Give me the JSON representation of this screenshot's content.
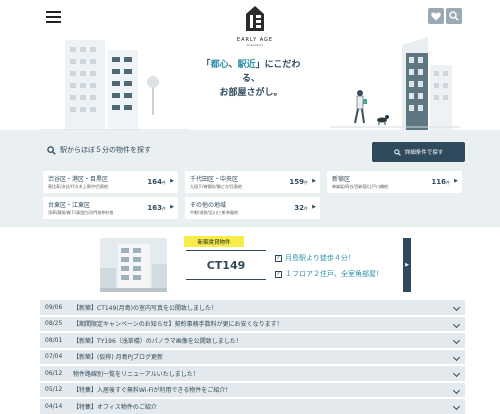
{
  "header": {
    "logo_text": "EARLY AGE",
    "logo_sub": "tsukishima",
    "tagline_line1_open": "「",
    "tagline_hl1": "都心",
    "tagline_sep": "、",
    "tagline_hl2": "駅近",
    "tagline_line1_rest": "」にこだわる、",
    "tagline_line2": "お部屋さがし。",
    "favorite_icon": "heart-icon",
    "search_icon": "search-icon"
  },
  "search": {
    "station_label": "駅からほぼ５分の物件を探す",
    "detail_button": "詳細条件で探す",
    "areas": [
      {
        "name": "渋谷区・港区・目黒区",
        "sub": "恵比寿/渋谷/代々木上原/中目黒他",
        "count": "164",
        "unit": "件"
      },
      {
        "name": "千代田区・中央区",
        "sub": "九段下/神保町/勝どき/月島他",
        "count": "159",
        "unit": "件"
      },
      {
        "name": "新宿区",
        "sub": "神楽坂/四谷/西新宿/江戸川橋他",
        "count": "116",
        "unit": "件"
      },
      {
        "name": "台東区・江東区",
        "sub": "浅草/蔵前/森下/清澄白河/門前仲町他",
        "count": "163",
        "unit": "件"
      },
      {
        "name": "その他の地域",
        "sub": "中野/池袋/品川/三軒茶屋他",
        "count": "32",
        "unit": "件"
      }
    ]
  },
  "new_property": {
    "badge": "新築賃貸物件",
    "name": "CT149",
    "feature1": "月島駅より徒歩４分！",
    "feature2": "１フロア２住戸、全室角部屋！"
  },
  "news": [
    {
      "date": "09/06",
      "title": "【新築】CT149(月島)の室内写真を公開致しました！"
    },
    {
      "date": "08/25",
      "title": "【期間限定キャンペーンのお知らせ】契約事務手数料が更にお安くなります！"
    },
    {
      "date": "08/01",
      "title": "【新築】TY196（浅草橋）のパノラマ画像を公開致しました！"
    },
    {
      "date": "07/04",
      "title": "【新築】(仮称) 月島PJブログ更新"
    },
    {
      "date": "06/12",
      "title": "物件路線別一覧をリニューアルいたしました！"
    },
    {
      "date": "05/12",
      "title": "【特集】入居後すぐ無料Wi-Fiが利用できる物件をご紹介！"
    },
    {
      "date": "04/14",
      "title": "【特集】オフィス物件のご紹介"
    }
  ],
  "colors": {
    "navy": "#2f4a5c",
    "teal": "#2c8fa6",
    "badge_yellow": "#f7ec4a",
    "panel_gray": "#eaeff1"
  }
}
